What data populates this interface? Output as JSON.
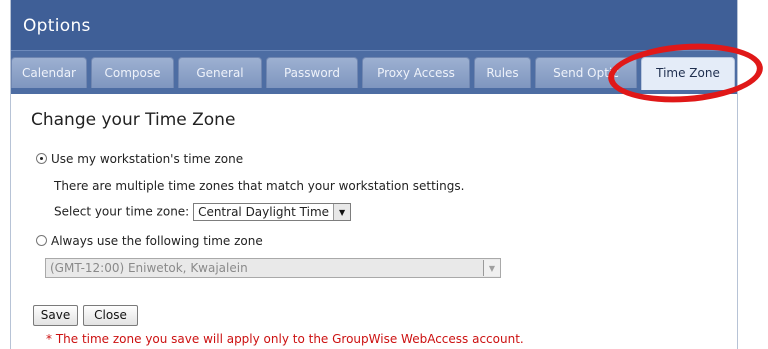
{
  "header": {
    "title": "Options"
  },
  "tabs": [
    {
      "label": "Calendar"
    },
    {
      "label": "Compose"
    },
    {
      "label": "General"
    },
    {
      "label": "Password"
    },
    {
      "label": "Proxy Access"
    },
    {
      "label": "Rules"
    },
    {
      "label": "Send Optic"
    },
    {
      "label": "Time Zone"
    }
  ],
  "active_tab": "Time Zone",
  "main": {
    "heading": "Change your Time Zone",
    "option_workstation_label": "Use my workstation's time zone",
    "option_workstation_selected": true,
    "multiple_zones_text": "There are multiple time zones that match your workstation settings.",
    "select_zone_label": "Select your time zone:",
    "select_zone_value": "Central Daylight Time",
    "option_always_label": "Always use the following time zone",
    "option_always_selected": false,
    "always_zone_value": "(GMT-12:00) Eniwetok, Kwajalein",
    "save_label": "Save",
    "close_label": "Close",
    "note": "* The time zone you save will apply only to the GroupWise WebAccess account."
  },
  "colors": {
    "header_bg": "#3f5f97",
    "tabbar_bg": "#4d6da3",
    "active_tab_bg": "#e4ecf8",
    "annotation_ring": "#e01818",
    "note_text": "#cc1111"
  },
  "icons": {
    "dropdown": "chevron-down-icon",
    "radio": "radio-icon"
  }
}
